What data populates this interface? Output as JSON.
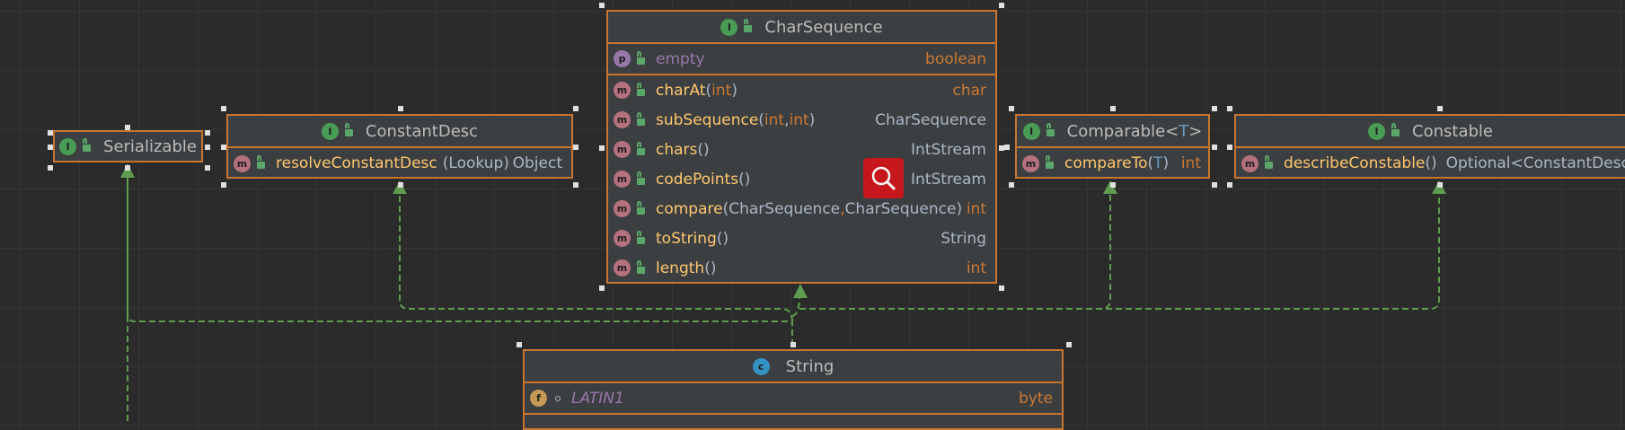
{
  "colors": {
    "background": "#2b2b2b",
    "border": "#c8752e",
    "arrow": "#5e9c4e",
    "method_name": "#ffc66d",
    "keyword": "#cc7832",
    "property": "#9876aa"
  },
  "serializable": {
    "icon": "I",
    "name": "Serializable"
  },
  "constant_desc": {
    "icon": "I",
    "name": "ConstantDesc",
    "members": [
      {
        "icon": "m",
        "name": "resolveConstantDesc",
        "params": "(Lookup)",
        "type": "Object"
      }
    ]
  },
  "char_sequence": {
    "icon": "I",
    "name": "CharSequence",
    "property": {
      "icon": "p",
      "name": "empty",
      "type": "boolean"
    },
    "methods": [
      {
        "icon": "m",
        "name": "charAt",
        "open": " (",
        "p1": "int",
        "close": ")",
        "type": "char"
      },
      {
        "icon": "m",
        "name": "subSequence",
        "open": " (",
        "p1": "int",
        "comma": ", ",
        "p2": "int",
        "close": ")",
        "type": "CharSequence"
      },
      {
        "icon": "m",
        "name": "chars",
        "open": " ()",
        "type": "IntStream"
      },
      {
        "icon": "m",
        "name": "codePoints",
        "open": " ()",
        "type": "IntStream"
      },
      {
        "icon": "m",
        "name": "compare",
        "open": " (",
        "p1": "CharSequence",
        "comma": " , ",
        "p2": "CharSequence",
        "close": " )",
        "type": "int"
      },
      {
        "icon": "m",
        "name": "toString",
        "open": " ()",
        "type": "String"
      },
      {
        "icon": "m",
        "name": "length",
        "open": " ()",
        "type": "int"
      }
    ]
  },
  "comparable": {
    "icon": "I",
    "name": "Comparable",
    "lt": " <",
    "tparam": "T",
    "gt": " >",
    "members": [
      {
        "icon": "m",
        "name": "compareTo",
        "open": " (",
        "p1": "T",
        "close": ")",
        "type": "int"
      }
    ]
  },
  "constable": {
    "icon": "I",
    "name": "Constable",
    "members": [
      {
        "icon": "m",
        "name": "describeConstable",
        "open": " ()",
        "type": "Optional<ConstantDesc"
      }
    ]
  },
  "string_class": {
    "icon": "c",
    "name": "String",
    "fields": [
      {
        "icon": "f",
        "name": "LATIN1",
        "type": "byte"
      }
    ]
  },
  "toolbar": {
    "search_icon": "search-icon"
  }
}
